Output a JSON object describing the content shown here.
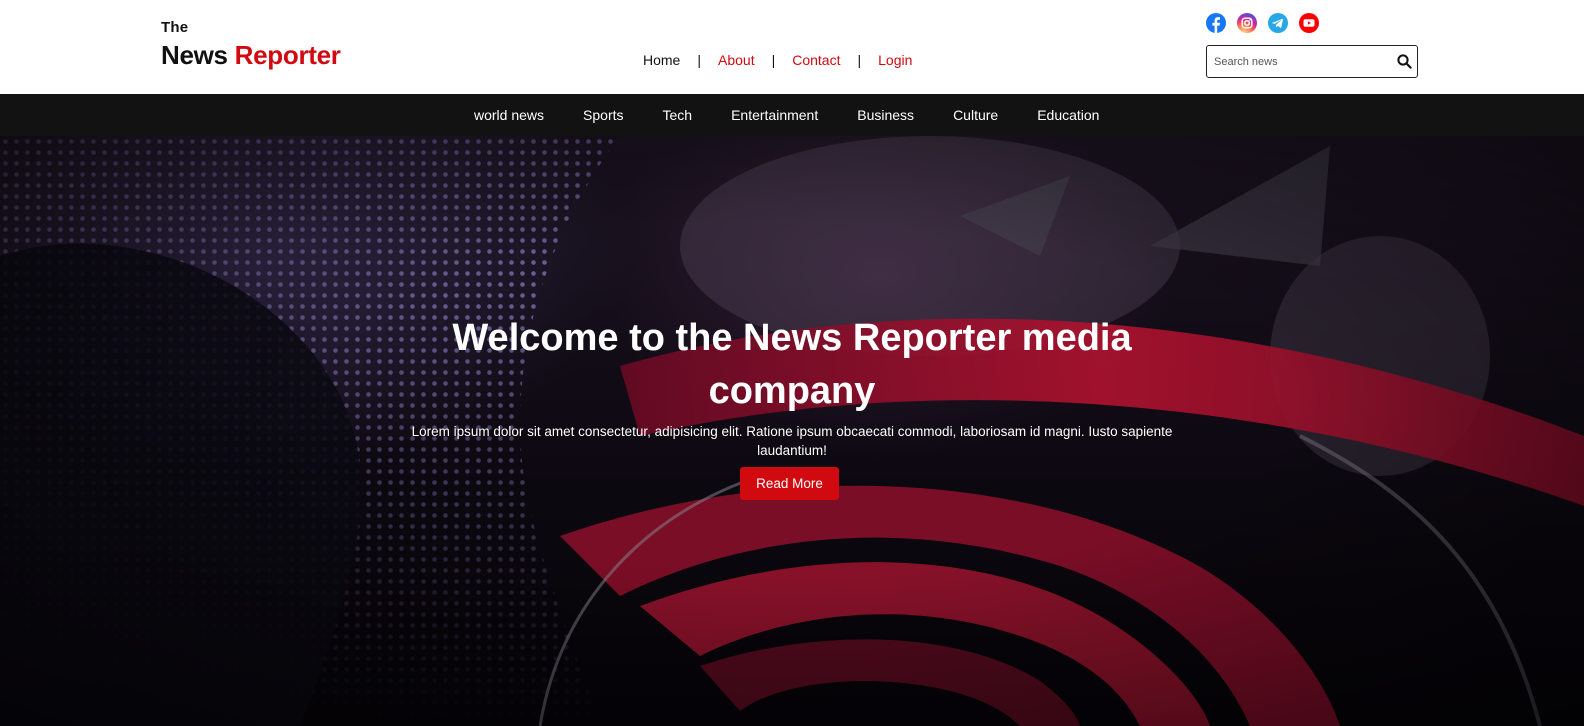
{
  "logo": {
    "small": "The",
    "word1": "News",
    "word2": "Reporter"
  },
  "topnav": [
    {
      "label": "Home"
    },
    {
      "label": "About"
    },
    {
      "label": "Contact"
    },
    {
      "label": "Login"
    }
  ],
  "separator": "|",
  "socials": {
    "facebook": "facebook-icon",
    "instagram": "instagram-icon",
    "telegram": "telegram-icon",
    "youtube": "youtube-icon"
  },
  "search": {
    "placeholder": "Search news",
    "value": ""
  },
  "categories": [
    {
      "label": "world news"
    },
    {
      "label": "Sports"
    },
    {
      "label": "Tech"
    },
    {
      "label": "Entertainment"
    },
    {
      "label": "Business"
    },
    {
      "label": "Culture"
    },
    {
      "label": "Education"
    }
  ],
  "hero": {
    "title": "Welcome to the News Reporter media company",
    "text": "Lorem ipsum dolor sit amet consectetur, adipisicing elit. Ratione ipsum obcaecati commodi, laboriosam id magni. Iusto sapiente laudantium!",
    "button": "Read More"
  },
  "colors": {
    "accent": "#d10a10",
    "navbar": "#121212",
    "header": "#ffffff"
  }
}
